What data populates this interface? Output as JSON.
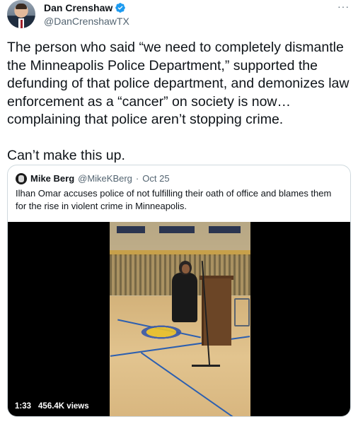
{
  "author": {
    "display_name": "Dan Crenshaw",
    "handle": "@DanCrenshawTX",
    "verified_icon": "verified-badge-icon",
    "more_icon": "more-options-icon"
  },
  "tweet": {
    "paragraph_1": "The person who said “we need to completely dismantle the Minneapolis Police Department,” supported the defunding of that police department, and demonizes law enforcement as a “cancer” on society is now… complaining that police aren’t stopping crime.",
    "paragraph_2": "Can’t make this up."
  },
  "quoted_tweet": {
    "display_name": "Mike Berg",
    "handle": "@MikeKBerg",
    "separator": "·",
    "date": "Oct 25",
    "text": "Ilhan Omar accuses police of not fulfilling their oath of office and blames them for the rise in violent crime in Minneapolis.",
    "video": {
      "duration": "1:33",
      "views": "456.4K views"
    }
  },
  "colors": {
    "verified_blue": "#1d9bf0",
    "secondary_text": "#536471",
    "border": "#cfd9de"
  }
}
